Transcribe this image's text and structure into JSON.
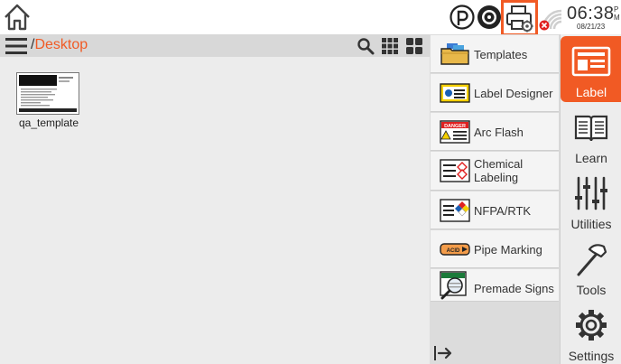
{
  "path": {
    "separator": "/",
    "segment": "Desktop"
  },
  "clock": {
    "time": "06:38",
    "ampm_top": "P",
    "ampm_bottom": "M",
    "date": "08/21/23"
  },
  "icons": {
    "home": "home-icon",
    "bluetooth_p": "p-logo-icon",
    "ribbon": "ribbon-roll-icon",
    "printer": "printer-settings-icon",
    "wifi": "wifi-disconnected-icon",
    "menu": "hamburger-menu-icon",
    "search": "search-icon",
    "grid_small": "small-grid-view-icon",
    "grid_large": "large-grid-view-icon",
    "collapse": "collapse-panel-icon"
  },
  "files": [
    {
      "name": "qa_template"
    }
  ],
  "categories": [
    {
      "label": "Templates",
      "icon": "folder-templates-icon"
    },
    {
      "label": "Label Designer",
      "icon": "label-designer-icon"
    },
    {
      "label": "Arc Flash",
      "icon": "arc-flash-icon"
    },
    {
      "label": "Chemical Labeling",
      "icon": "chemical-labeling-icon"
    },
    {
      "label": "NFPA/RTK",
      "icon": "nfpa-rtk-icon"
    },
    {
      "label": "Pipe Marking",
      "icon": "pipe-marking-icon"
    },
    {
      "label": "Premade Signs",
      "icon": "premade-signs-icon"
    }
  ],
  "nav": [
    {
      "label": "Label",
      "icon": "label-icon",
      "active": true
    },
    {
      "label": "Learn",
      "icon": "book-icon",
      "active": false
    },
    {
      "label": "Utilities",
      "icon": "sliders-icon",
      "active": false
    },
    {
      "label": "Tools",
      "icon": "hammer-icon",
      "active": false
    },
    {
      "label": "Settings",
      "icon": "gear-icon",
      "active": false
    }
  ],
  "colors": {
    "accent": "#f15a24",
    "panel": "#dcdcdc",
    "background": "#ececec"
  }
}
